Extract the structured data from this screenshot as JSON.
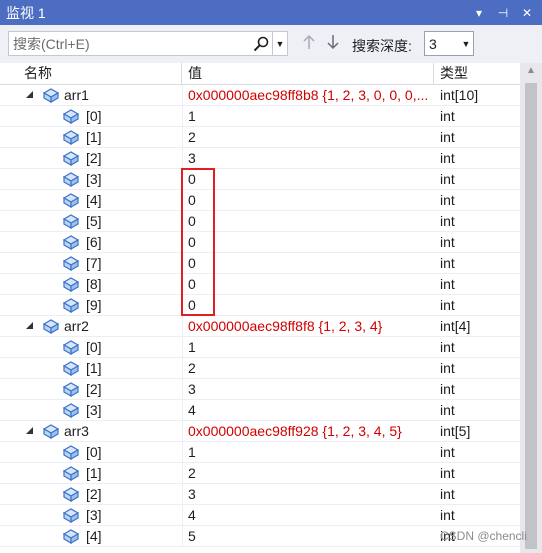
{
  "window": {
    "title": "监视 1",
    "controls": [
      "▾",
      "⊣",
      "✕"
    ]
  },
  "toolbar": {
    "search_placeholder": "搜索(Ctrl+E)",
    "depth_label": "搜索深度:",
    "depth_value": "3"
  },
  "columns": {
    "name": "名称",
    "value": "值",
    "type": "类型"
  },
  "rows": [
    {
      "name": "arr1",
      "value": "0x000000aec98ff8b8 {1, 2, 3, 0, 0, 0,...",
      "type": "int[10]",
      "level": 0,
      "red": true
    },
    {
      "name": "[0]",
      "value": "1",
      "type": "int",
      "level": 1,
      "red": false
    },
    {
      "name": "[1]",
      "value": "2",
      "type": "int",
      "level": 1,
      "red": false
    },
    {
      "name": "[2]",
      "value": "3",
      "type": "int",
      "level": 1,
      "red": false
    },
    {
      "name": "[3]",
      "value": "0",
      "type": "int",
      "level": 1,
      "red": false
    },
    {
      "name": "[4]",
      "value": "0",
      "type": "int",
      "level": 1,
      "red": false
    },
    {
      "name": "[5]",
      "value": "0",
      "type": "int",
      "level": 1,
      "red": false
    },
    {
      "name": "[6]",
      "value": "0",
      "type": "int",
      "level": 1,
      "red": false
    },
    {
      "name": "[7]",
      "value": "0",
      "type": "int",
      "level": 1,
      "red": false
    },
    {
      "name": "[8]",
      "value": "0",
      "type": "int",
      "level": 1,
      "red": false
    },
    {
      "name": "[9]",
      "value": "0",
      "type": "int",
      "level": 1,
      "red": false
    },
    {
      "name": "arr2",
      "value": "0x000000aec98ff8f8 {1, 2, 3, 4}",
      "type": "int[4]",
      "level": 0,
      "red": true
    },
    {
      "name": "[0]",
      "value": "1",
      "type": "int",
      "level": 1,
      "red": false
    },
    {
      "name": "[1]",
      "value": "2",
      "type": "int",
      "level": 1,
      "red": false
    },
    {
      "name": "[2]",
      "value": "3",
      "type": "int",
      "level": 1,
      "red": false
    },
    {
      "name": "[3]",
      "value": "4",
      "type": "int",
      "level": 1,
      "red": false
    },
    {
      "name": "arr3",
      "value": "0x000000aec98ff928 {1, 2, 3, 4, 5}",
      "type": "int[5]",
      "level": 0,
      "red": true
    },
    {
      "name": "[0]",
      "value": "1",
      "type": "int",
      "level": 1,
      "red": false
    },
    {
      "name": "[1]",
      "value": "2",
      "type": "int",
      "level": 1,
      "red": false
    },
    {
      "name": "[2]",
      "value": "3",
      "type": "int",
      "level": 1,
      "red": false
    },
    {
      "name": "[3]",
      "value": "4",
      "type": "int",
      "level": 1,
      "red": false
    },
    {
      "name": "[4]",
      "value": "5",
      "type": "int",
      "level": 1,
      "red": false
    }
  ],
  "watermark": "CSDN @chencli",
  "colors": {
    "titlebar": "#4c6dc2",
    "changed_value": "#d20000",
    "highlight_box": "#e02020",
    "icon": "#3a73c8"
  }
}
